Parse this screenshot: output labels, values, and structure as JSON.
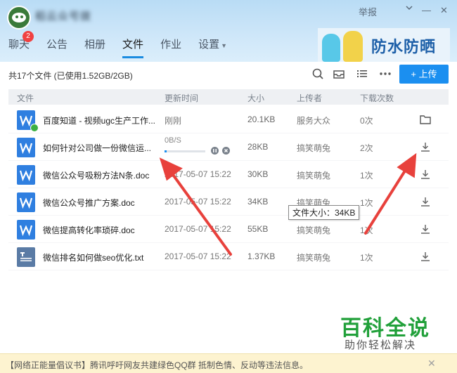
{
  "window": {
    "group_title": "稻云众号拨",
    "report_label": "举报",
    "minimize_glyph": "—",
    "close_glyph": "✕"
  },
  "tabs": [
    {
      "label": "聊天",
      "badge": "2"
    },
    {
      "label": "公告"
    },
    {
      "label": "相册"
    },
    {
      "label": "文件",
      "active": true
    },
    {
      "label": "作业"
    },
    {
      "label": "设置"
    }
  ],
  "banner": {
    "text": "防水防晒"
  },
  "toolbar": {
    "file_count": "共17个文件 (已使用1.52GB/2GB)",
    "upload_label": "+ 上传",
    "icons": [
      "search-icon",
      "inbox-icon",
      "list-view-icon",
      "more-icon"
    ]
  },
  "table": {
    "headers": {
      "name": "文件",
      "time": "更新时间",
      "size": "大小",
      "uploader": "上传者",
      "downloads": "下载次数"
    },
    "rows": [
      {
        "icon": "W",
        "verified": true,
        "name": "百度知道 - 视频ugc生产工作...",
        "time": "刚刚",
        "size": "20.1KB",
        "uploader": "服务大众",
        "downloads": "0次",
        "action": "folder-icon"
      },
      {
        "icon": "W",
        "name": "如何针对公司做一份微信运...",
        "progress_text": "0B/S",
        "progress": 0.05,
        "size": "28KB",
        "uploader": "搞笑萌兔",
        "downloads": "2次",
        "action": "download-icon"
      },
      {
        "icon": "W",
        "name": "微信公众号吸粉方法N条.doc",
        "time": "2017-05-07 15:22",
        "size": "30KB",
        "uploader": "搞笑萌兔",
        "downloads": "1次",
        "action": "download-icon"
      },
      {
        "icon": "W",
        "name": "微信公众号推广方案.doc",
        "time": "2017-05-07 15:22",
        "size": "34KB",
        "uploader": "搞笑萌兔",
        "downloads": "1次",
        "action": "download-icon"
      },
      {
        "icon": "W",
        "name": "微信提高转化率琐碎.doc",
        "time": "2017-05-07 15:22",
        "size": "55KB",
        "uploader": "搞笑萌兔",
        "downloads": "1次",
        "action": "download-icon"
      },
      {
        "icon": "TXT",
        "name": "微信排名如何做seo优化.txt",
        "time": "2017-05-07 15:22",
        "size": "1.37KB",
        "uploader": "搞笑萌兔",
        "downloads": "1次",
        "action": "download-icon"
      }
    ]
  },
  "tooltip": "文件大小：34KB",
  "watermark": {
    "title": "百科全说",
    "subtitle": "助你轻松解决"
  },
  "footer": {
    "text": "【网络正能量倡议书】腾讯呼吁网友共建绿色QQ群 抵制色情、反动等违法信息。",
    "close_glyph": "✕"
  },
  "colors": {
    "accent": "#1b8ff0",
    "arrow": "#e8413c",
    "word_icon": "#2f7fe0"
  }
}
